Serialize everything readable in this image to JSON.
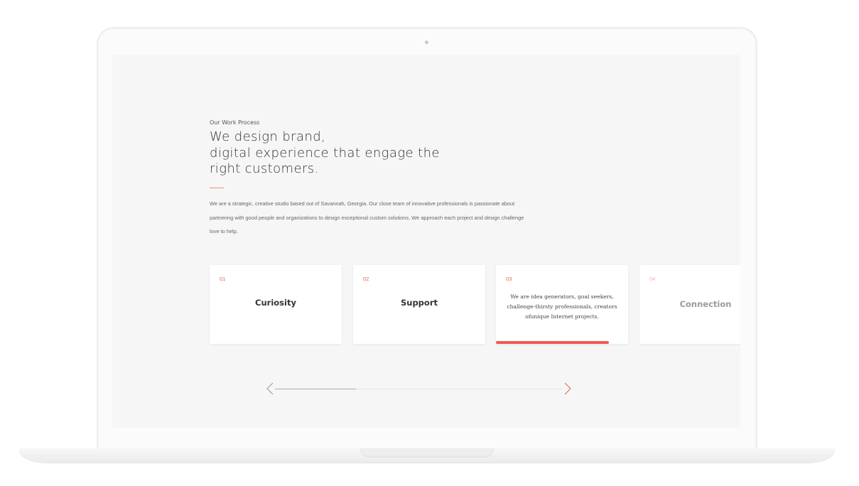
{
  "section": {
    "eyebrow": "Our Work Process",
    "headline_lines": [
      "We design brand,",
      "digital experience that engage the",
      "right customers."
    ],
    "intro_lines": [
      "We are a strategic, creative studio based out of Savannah, Georgia. Our close team of innovative professionals is passionate about",
      "partnering with good people and organizations to design exceptional custom solutions. We approach each project and design challenge",
      "love to help."
    ]
  },
  "cards": [
    {
      "num": "01",
      "title": "Curiosity"
    },
    {
      "num": "02",
      "title": "Support"
    },
    {
      "num": "03",
      "desc_lines": [
        "We are idea generators, goal seekers,",
        "challenge-thirsty professionals, creators",
        "ofunique Internet projects."
      ],
      "active": true
    },
    {
      "num": "04",
      "title": "Connection"
    }
  ],
  "slider": {
    "progress": 0.28,
    "prev_icon": "chevron-left-icon",
    "next_icon": "chevron-right-icon"
  },
  "colors": {
    "accent": "#ee5b52",
    "background": "#f6f6f6"
  }
}
